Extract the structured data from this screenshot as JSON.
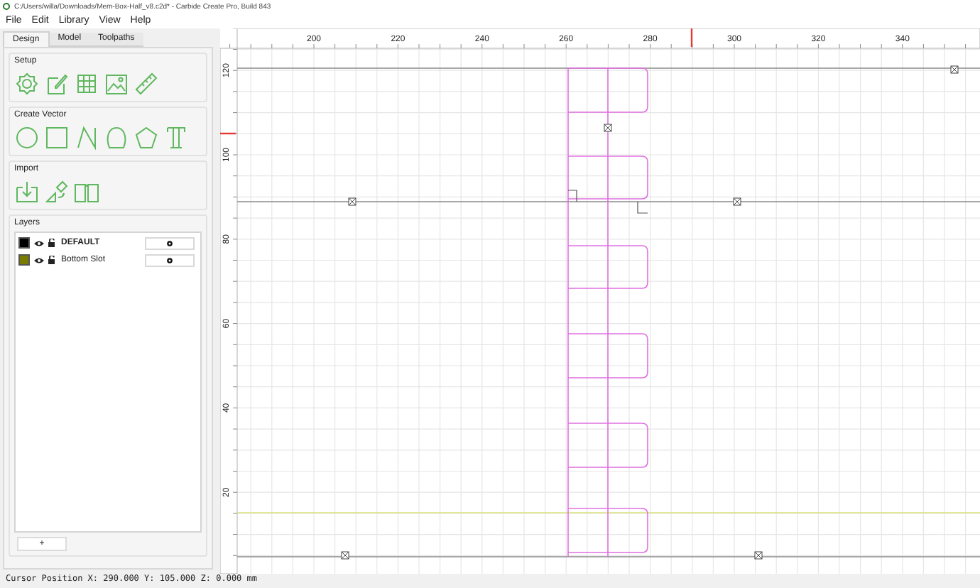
{
  "window": {
    "title": "C:/Users/willa/Downloads/Mem-Box-Half_v8.c2d* - Carbide Create Pro, Build 843"
  },
  "menu": [
    "File",
    "Edit",
    "Library",
    "View",
    "Help"
  ],
  "tabs": [
    {
      "label": "Design",
      "selected": true
    },
    {
      "label": "Model",
      "selected": false
    },
    {
      "label": "Toolpaths",
      "selected": false
    }
  ],
  "groups": [
    {
      "title": "Setup",
      "tools": [
        {
          "kind": "gear"
        },
        {
          "kind": "edit"
        },
        {
          "kind": "grid"
        },
        {
          "kind": "image"
        },
        {
          "kind": "ruler"
        }
      ]
    },
    {
      "title": "Create Vector",
      "tools": [
        {
          "kind": "circle"
        },
        {
          "kind": "square"
        },
        {
          "kind": "polyline"
        },
        {
          "kind": "curve"
        },
        {
          "kind": "pentagon"
        },
        {
          "kind": "text"
        }
      ]
    },
    {
      "title": "Import",
      "tools": [
        {
          "kind": "import"
        },
        {
          "kind": "trace"
        },
        {
          "kind": "book"
        }
      ]
    }
  ],
  "layers": {
    "title": "Layers",
    "items": [
      {
        "name": "DEFAULT",
        "color": "#000000",
        "selected": true
      },
      {
        "name": "Bottom Slot",
        "color": "#7a7a00",
        "selected": false
      }
    ],
    "add_button": "+"
  },
  "canvas": {
    "x_ticks": [
      "200",
      "220",
      "240",
      "260",
      "280",
      "300",
      "320",
      "340"
    ],
    "y_ticks": [
      "120",
      "100",
      "80",
      "60",
      "40",
      "20"
    ]
  },
  "status_bar": "Cursor Position X: 290.000 Y: 105.000 Z: 0.000 mm"
}
